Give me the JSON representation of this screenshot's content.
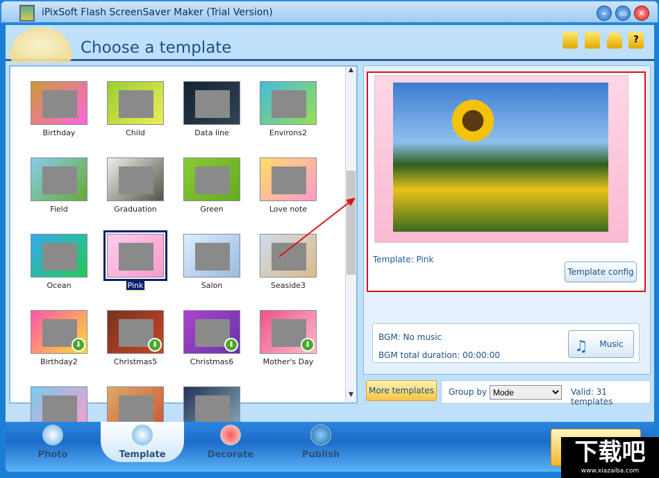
{
  "window": {
    "title": "iPixSoft Flash ScreenSaver Maker (Trial Version)",
    "buttons": [
      "minimize",
      "maximize",
      "close"
    ]
  },
  "header": {
    "title": "Choose a template",
    "toolbar_icons": [
      "folder-icon",
      "save-icon",
      "user-icon",
      "help-icon"
    ]
  },
  "templates": [
    {
      "label": "Birthday",
      "colors": [
        "#c93",
        "#f6d"
      ],
      "download": false
    },
    {
      "label": "Child",
      "colors": [
        "#9c3",
        "#ee5"
      ],
      "download": false
    },
    {
      "label": "Data line",
      "colors": [
        "#123",
        "#345"
      ],
      "download": false
    },
    {
      "label": "Environs2",
      "colors": [
        "#4bd",
        "#9d5"
      ],
      "download": false
    },
    {
      "label": "Field",
      "colors": [
        "#8ce",
        "#6a3"
      ],
      "download": false
    },
    {
      "label": "Graduation",
      "colors": [
        "#eee",
        "#554"
      ],
      "download": false
    },
    {
      "label": "Green",
      "colors": [
        "#8c3",
        "#6a2"
      ],
      "download": false
    },
    {
      "label": "Love note",
      "colors": [
        "#fd6",
        "#f9c"
      ],
      "download": false
    },
    {
      "label": "Ocean",
      "colors": [
        "#3ae",
        "#2c5"
      ],
      "download": false
    },
    {
      "label": "Pink",
      "colors": [
        "#fce",
        "#f9c"
      ],
      "download": false,
      "selected": true
    },
    {
      "label": "Salon",
      "colors": [
        "#def",
        "#9bd"
      ],
      "download": false
    },
    {
      "label": "Seaside3",
      "colors": [
        "#cde",
        "#db8"
      ],
      "download": false
    },
    {
      "label": "Birthday2",
      "colors": [
        "#f5a",
        "#fd3"
      ],
      "download": true
    },
    {
      "label": "Christmas5",
      "colors": [
        "#732",
        "#c42"
      ],
      "download": true
    },
    {
      "label": "Christmas6",
      "colors": [
        "#a4c",
        "#63a"
      ],
      "download": true
    },
    {
      "label": "Mother's Day",
      "colors": [
        "#e58",
        "#fbc"
      ],
      "download": true
    },
    {
      "label": "",
      "colors": [
        "#7ce",
        "#f9c"
      ],
      "download": false
    },
    {
      "label": "",
      "colors": [
        "#da6",
        "#c53"
      ],
      "download": false
    },
    {
      "label": "",
      "colors": [
        "#235",
        "#8ab"
      ],
      "download": false
    }
  ],
  "preview": {
    "template_label": "Template: Pink",
    "config_button": "Template config"
  },
  "bgm": {
    "music": "BGM: No music",
    "duration": "BGM total duration: 00:00:00",
    "music_button": "Music"
  },
  "footer": {
    "more_templates": "More templates",
    "group_by_label": "Group by",
    "group_by_value": "Mode",
    "valid": "Valid: 31 templates"
  },
  "nav": [
    {
      "label": "Photo"
    },
    {
      "label": "Template",
      "active": true
    },
    {
      "label": "Decorate"
    },
    {
      "label": "Publish"
    }
  ],
  "watermark": {
    "text": "下载吧",
    "url": "www.xiazaiba.com"
  }
}
